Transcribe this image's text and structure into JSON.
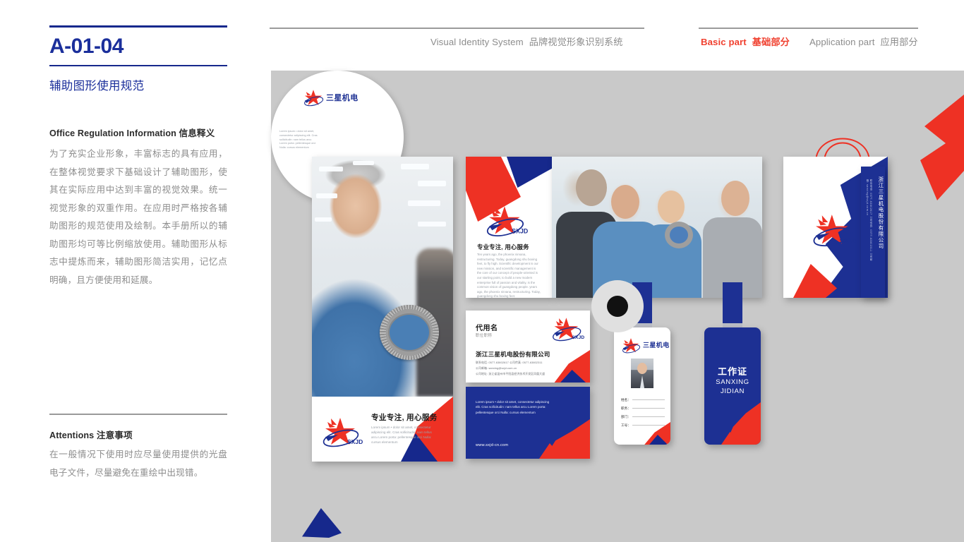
{
  "sidebar": {
    "doc_code": "A-01-04",
    "doc_subtitle": "辅助图形使用规范",
    "info_heading_en": "Office Regulation Information",
    "info_heading_cn": "信息释义",
    "info_body": "为了充实企业形象，丰富标志的具有应用，在整体视觉要求下基础设计了辅助图形，使其在实际应用中达到丰富的视觉效果。统一视觉形象的双重作用。在应用时严格按各辅助图形的规范使用及绘制。本手册所以的辅助图形均可等比例缩放使用。辅助图形从标志中提炼而来，辅助图形简洁实用，记忆点明确，且方便使用和延展。",
    "attentions_heading_en": "Attentions",
    "attentions_heading_cn": "注意事项",
    "attentions_body": "在一般情况下使用时应尽量使用提供的光盘电子文件，尽量避免在重绘中出现错。"
  },
  "topnav": {
    "visual_identity_en": "Visual Identity System",
    "visual_identity_cn": "品牌视觉形象识别系统",
    "basic_part_en": "Basic part",
    "basic_part_cn": "基础部分",
    "application_part_en": "Application part",
    "application_part_cn": "应用部分"
  },
  "brand": {
    "logo_wordmark": "SXJD",
    "logo_cn": "三星机电",
    "navy": "#1d3093",
    "red": "#ee3124",
    "accent_red": "#f0402f",
    "canvas_gray": "#c9c9c9"
  },
  "poster": {
    "slogan": "专业专注, 用心服务",
    "body": "Lorem ipsum • dolor sit amet, consectetur adipiscing elit. Cras sollicitudin: nam tellus arcu Lorem porta: pellentesque orci Nulla: cursus elementum"
  },
  "brochure": {
    "slogan": "专业专注, 用心服务",
    "body": "Ten years ago, the phoenix nirvana, restructuring. Today, guangdong shu boxing feet, to fly high. Scientific development is our new mission, and scientific management is the core of our concept of people-oriented is our starting point, to build a new modern enterprise full of passion and vitality, is the common vision of guangdong people. years ago, the phoenix nirvana, restructuring. Today, guangdong shu boxing feet."
  },
  "namecard": {
    "name": "代用名",
    "job_title": "职位职称",
    "company": "浙江三星机电股份有限公司",
    "line1": "联系电话: 0577-63802617    公司传真: 0577-63802311",
    "line2": "公司邮箱: sanxing@sxjd.com.cn",
    "line3": "公司地址: 浙江省温州市平阳县经济技术开发区凤凰大道"
  },
  "bluecard": {
    "body": "Lorem ipsum • dolor sit amet, consectetur adipiscing elit. Cras sollicitudin: nam tellus arcu Lorem porta: pellentesque orci Nulla: cursus elementum",
    "url": "www.sxjd-cn.com"
  },
  "badge": {
    "logo_cn": "三星机电",
    "field_name": "姓名：",
    "field_position": "职务：",
    "field_department": "部门：",
    "field_number": "工号：",
    "back_title": "工作证",
    "back_sub1": "SANXING",
    "back_sub2": "JIDIAN"
  },
  "bag": {
    "side_text": "浙江三星机电股份有限公司",
    "side_sub": "联系电话: 0577-63802617  公司传真: 0577-63802311  公司邮箱: sanxing@sxjd.com.cn"
  },
  "cd": {
    "logo_cn": "三星机电",
    "body": "Lorem ipsum • dolor sit amet, consectetur adipiscing elit. Cras sollicitudin: nam tellus arcu Lorem porta: pellentesque orci Nulla: cursus elementum"
  }
}
